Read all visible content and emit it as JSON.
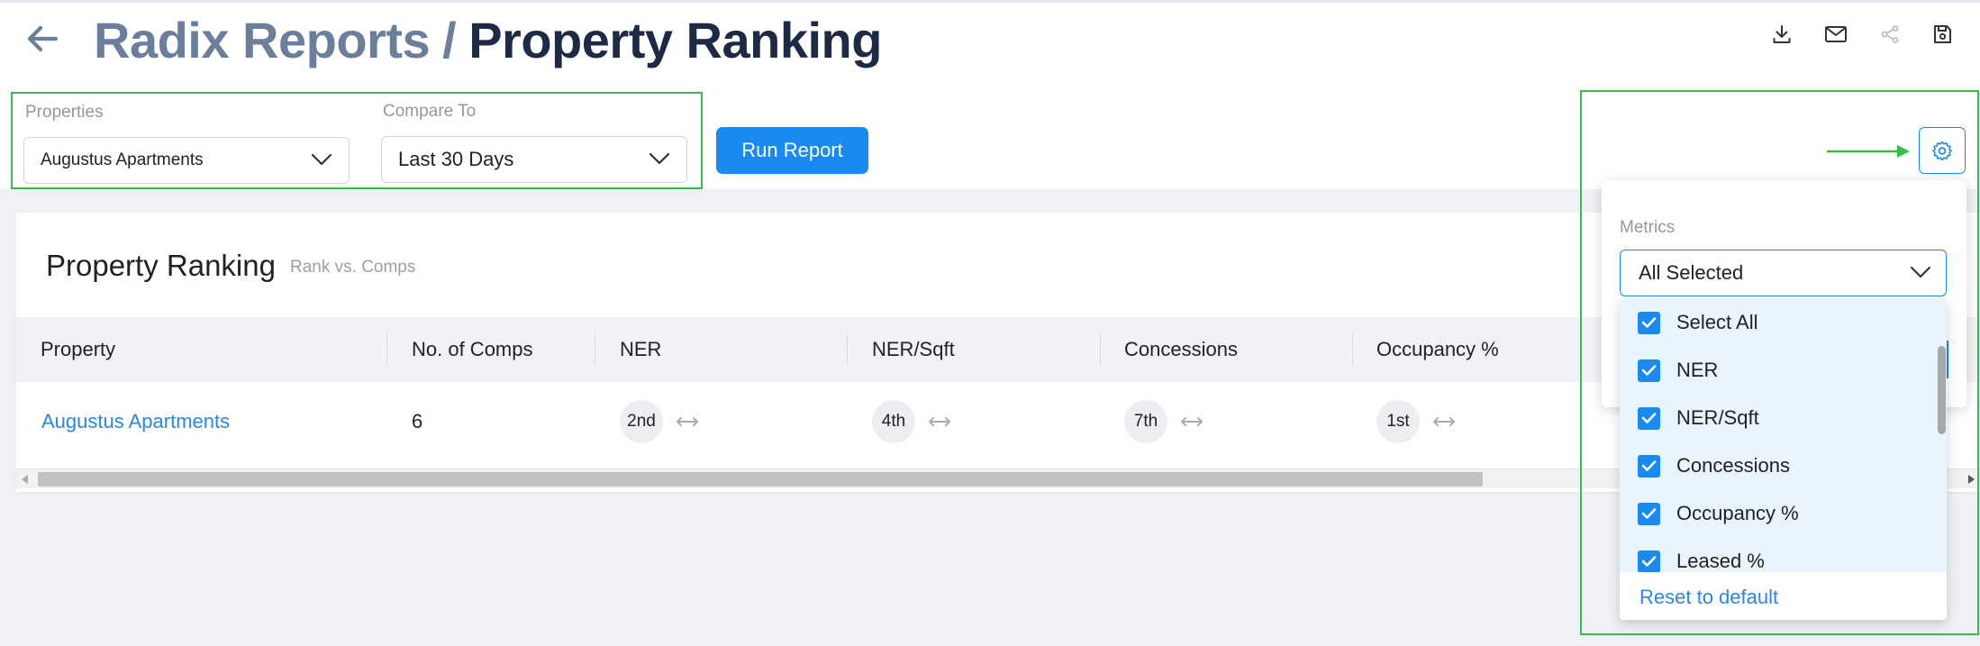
{
  "header": {
    "app_title": "Radix Reports",
    "separator": "/",
    "page_title": "Property Ranking",
    "actions": [
      {
        "name": "download-icon"
      },
      {
        "name": "email-icon"
      },
      {
        "name": "share-icon"
      },
      {
        "name": "save-icon"
      }
    ]
  },
  "filters": {
    "properties": {
      "label": "Properties",
      "value": "Augustus Apartments"
    },
    "compare_to": {
      "label": "Compare To",
      "value": "Last 30 Days"
    },
    "run_label": "Run Report"
  },
  "colors": {
    "accent": "#1b8af0",
    "highlight": "#3bbb4a",
    "title_muted": "#6b7f9c",
    "title_dark": "#1c2a45",
    "link": "#2a86e8"
  },
  "card": {
    "title": "Property Ranking",
    "subtitle": "Rank vs. Comps"
  },
  "table": {
    "columns": [
      "Property",
      "No. of Comps",
      "NER",
      "NER/Sqft",
      "Concessions",
      "Occupancy %"
    ],
    "rows": [
      {
        "property": "Augustus Apartments",
        "comps": "6",
        "ner": "2nd",
        "ner_sqft": "4th",
        "concessions": "7th",
        "occupancy": "1st",
        "trend_icon": "horizontal-arrows-icon"
      }
    ]
  },
  "metrics": {
    "label": "Metrics",
    "selected": "All Selected",
    "options": [
      {
        "label": "Select All",
        "checked": true
      },
      {
        "label": "NER",
        "checked": true
      },
      {
        "label": "NER/Sqft",
        "checked": true
      },
      {
        "label": "Concessions",
        "checked": true
      },
      {
        "label": "Occupancy %",
        "checked": true
      },
      {
        "label": "Leased %",
        "checked": true
      }
    ],
    "reset_label": "Reset to default"
  }
}
